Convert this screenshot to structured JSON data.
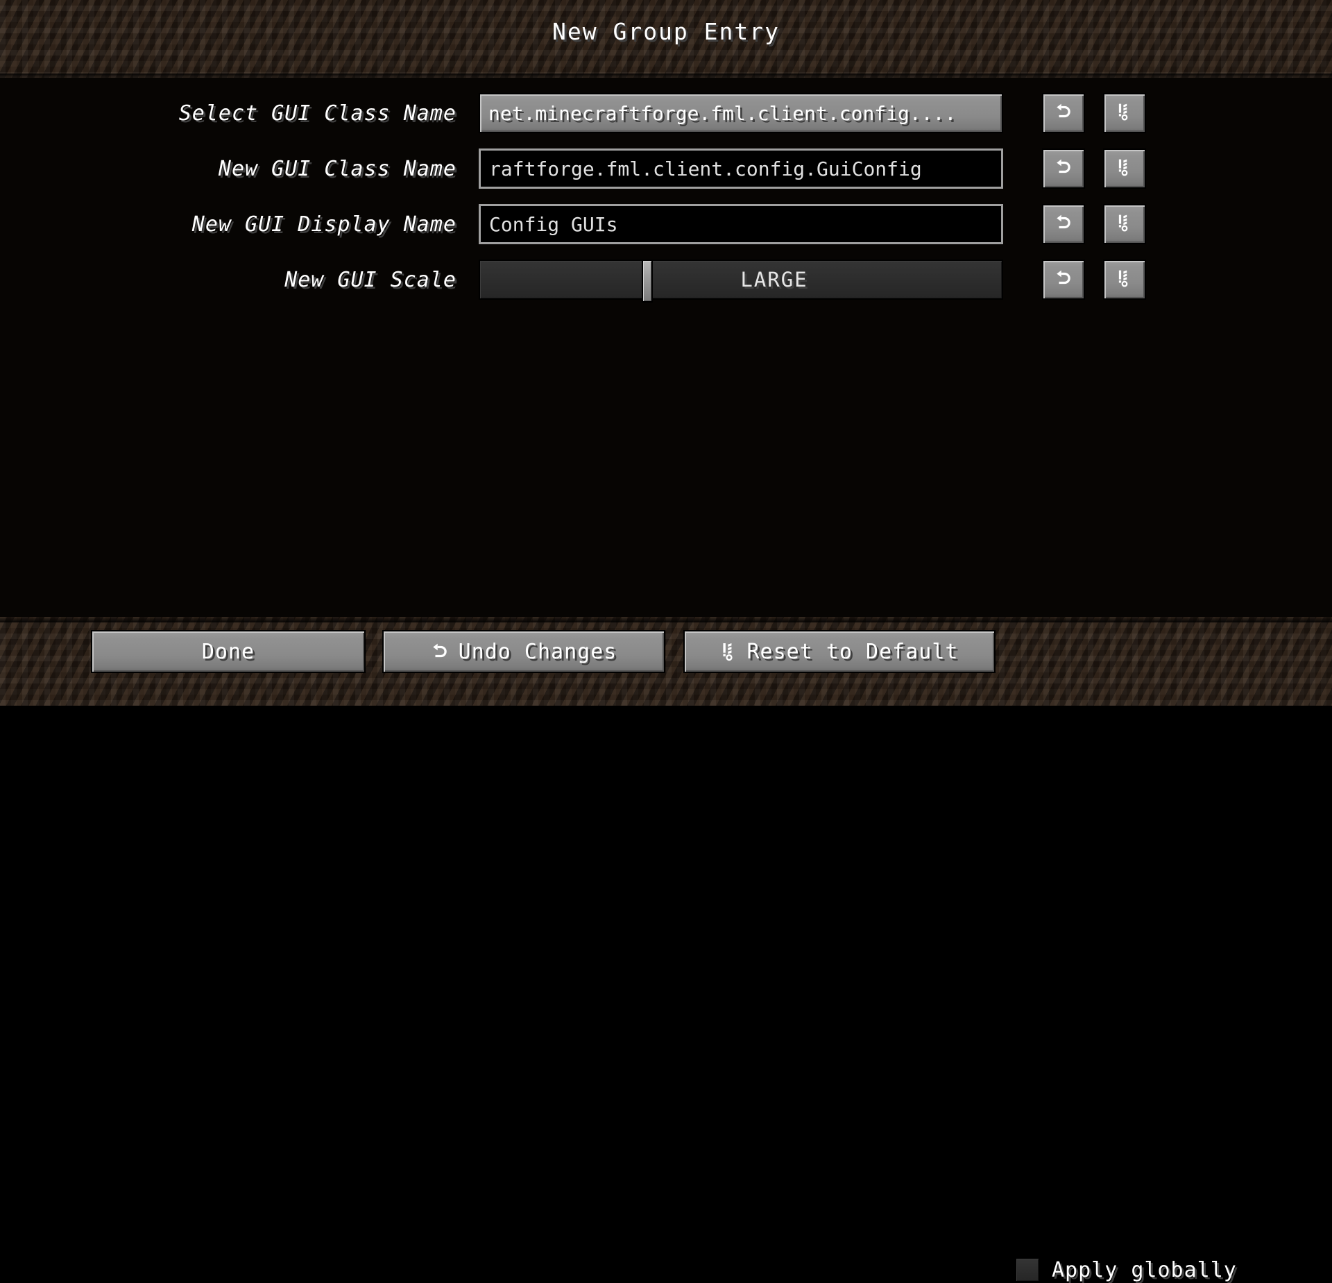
{
  "window": {
    "title": "New Group Entry"
  },
  "rows": [
    {
      "label": "Select GUI Class Name",
      "control": "button",
      "value": "net.minecraftforge.fml.client.config....",
      "undo_icon": "undo-arrow-icon",
      "reset_icon": "reset-to-default-icon"
    },
    {
      "label": "New GUI Class Name",
      "control": "textfield",
      "value": "raftforge.fml.client.config.GuiConfig",
      "undo_icon": "undo-arrow-icon",
      "reset_icon": "reset-to-default-icon"
    },
    {
      "label": "New GUI Display Name",
      "control": "textfield",
      "value": "Config GUIs",
      "undo_icon": "undo-arrow-icon",
      "reset_icon": "reset-to-default-icon"
    },
    {
      "label": "New GUI Scale",
      "control": "slider",
      "value": "LARGE",
      "slider_percent": 32,
      "undo_icon": "undo-arrow-icon",
      "reset_icon": "reset-to-default-icon"
    }
  ],
  "footer": {
    "done_label": "Done",
    "undo_label": "Undo Changes",
    "reset_label": "Reset to Default",
    "apply_globally_label": "Apply globally",
    "apply_globally_checked": false
  },
  "colors": {
    "background_dirt": "#2a1e15",
    "body_background": "#070503",
    "button_face": "#8b8b8b",
    "button_highlight": "#c6c6c6",
    "button_shadow": "#555555",
    "text": "#ffffff",
    "text_shadow": "#3f3f3f",
    "textfield_background": "#000000",
    "textfield_border": "#a0a0a0",
    "slider_track": "#2f2f2f"
  }
}
